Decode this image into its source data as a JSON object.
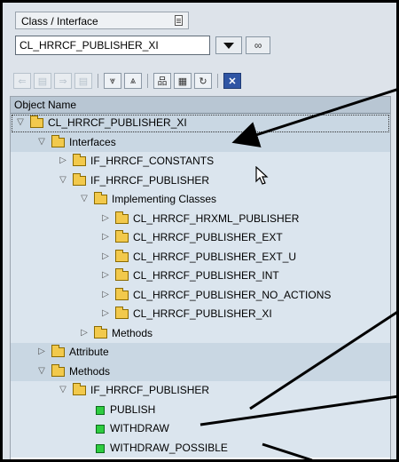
{
  "selector": {
    "label": "Class / Interface",
    "value": "CL_HRRCF_PUBLISHER_XI"
  },
  "toolbar": {
    "buttons": [
      {
        "icon": "back-arrow-icon",
        "glyph": "⇐",
        "disabled": true
      },
      {
        "icon": "doc-icon-1",
        "glyph": "▤",
        "disabled": true
      },
      {
        "icon": "forward-arrow-icon",
        "glyph": "⇒",
        "disabled": true
      },
      {
        "icon": "doc-icon-2",
        "glyph": "▤",
        "disabled": true
      },
      {
        "icon": "expand-all-icon",
        "glyph": "⩔",
        "disabled": false
      },
      {
        "icon": "collapse-all-icon",
        "glyph": "⩓",
        "disabled": false
      },
      {
        "icon": "hierarchy-icon",
        "glyph": "品",
        "disabled": false
      },
      {
        "icon": "layout-icon",
        "glyph": "▦",
        "disabled": false
      },
      {
        "icon": "refresh-icon",
        "glyph": "↻",
        "disabled": false
      },
      {
        "icon": "close-icon",
        "glyph": "✕",
        "disabled": false
      }
    ]
  },
  "tree": {
    "header": "Object Name",
    "rows": [
      {
        "text": "CL_HRRCF_PUBLISHER_XI",
        "level": 0,
        "expander": "▽",
        "icon": "folder",
        "band": "band",
        "focus": true
      },
      {
        "text": "Interfaces",
        "level": 1,
        "expander": "▽",
        "icon": "folder",
        "band": "band"
      },
      {
        "text": "IF_HRRCF_CONSTANTS",
        "level": 2,
        "expander": "▷",
        "icon": "folder",
        "band": "band2"
      },
      {
        "text": "IF_HRRCF_PUBLISHER",
        "level": 2,
        "expander": "▽",
        "icon": "folder-open",
        "band": "band2"
      },
      {
        "text": "Implementing Classes",
        "level": 3,
        "expander": "▽",
        "icon": "folder",
        "band": "band2"
      },
      {
        "text": "CL_HRRCF_HRXML_PUBLISHER",
        "level": 4,
        "expander": "▷",
        "icon": "folder",
        "band": "band2"
      },
      {
        "text": "CL_HRRCF_PUBLISHER_EXT",
        "level": 4,
        "expander": "▷",
        "icon": "folder",
        "band": "band2"
      },
      {
        "text": "CL_HRRCF_PUBLISHER_EXT_U",
        "level": 4,
        "expander": "▷",
        "icon": "folder",
        "band": "band2"
      },
      {
        "text": "CL_HRRCF_PUBLISHER_INT",
        "level": 4,
        "expander": "▷",
        "icon": "folder",
        "band": "band2"
      },
      {
        "text": "CL_HRRCF_PUBLISHER_NO_ACTIONS",
        "level": 4,
        "expander": "▷",
        "icon": "folder",
        "band": "band2"
      },
      {
        "text": "CL_HRRCF_PUBLISHER_XI",
        "level": 4,
        "expander": "▷",
        "icon": "folder",
        "band": "band2"
      },
      {
        "text": "Methods",
        "level": 3,
        "expander": "▷",
        "icon": "folder",
        "band": "band2"
      },
      {
        "text": "Attribute",
        "level": 1,
        "expander": "▷",
        "icon": "folder",
        "band": "band"
      },
      {
        "text": "Methods",
        "level": 1,
        "expander": "▽",
        "icon": "folder",
        "band": "band"
      },
      {
        "text": "IF_HRRCF_PUBLISHER",
        "level": 2,
        "expander": "▽",
        "icon": "folder-open",
        "band": "band2"
      },
      {
        "text": "PUBLISH",
        "level": 3,
        "expander": "",
        "icon": "leaf",
        "band": "band2"
      },
      {
        "text": "WITHDRAW",
        "level": 3,
        "expander": "",
        "icon": "leaf",
        "band": "band2"
      },
      {
        "text": "WITHDRAW_POSSIBLE",
        "level": 3,
        "expander": "",
        "icon": "leaf",
        "band": "band2"
      }
    ]
  },
  "colors": {
    "band": "#c9d7e3",
    "band2": "#dbe5ee",
    "leaf": "#2ecc40",
    "folder": "#f2c94c",
    "arrow": "#000000"
  }
}
